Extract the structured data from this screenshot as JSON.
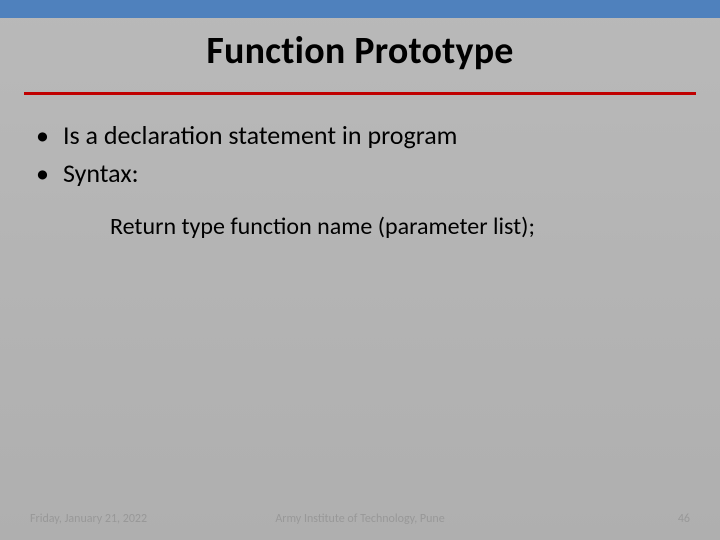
{
  "title": "Function Prototype",
  "bullets": [
    "Is a declaration statement in program",
    "Syntax:"
  ],
  "syntax_line": "Return type function name (parameter list);",
  "footer": {
    "date": "Friday, January 21, 2022",
    "org": "Army Institute of Technology, Pune",
    "page": "46"
  }
}
